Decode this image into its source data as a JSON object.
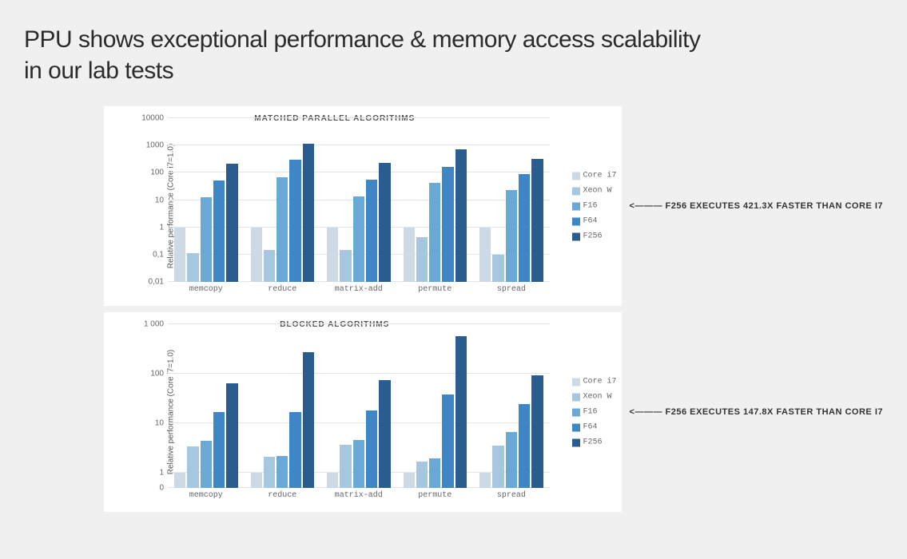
{
  "title_line1": "PPU shows exceptional performance & memory access scalability",
  "title_line2": "in our lab tests",
  "colors": {
    "Core i7": "#cdd9e5",
    "Xeon W": "#a7c6df",
    "F16": "#6aa9d6",
    "F64": "#3f86c4",
    "F256": "#2a5d8f"
  },
  "chart_data": [
    {
      "type": "bar",
      "title": "MATCHED PARALLEL ALGORITHMS",
      "ylabel": "Relative performance (Core i7=1.0)",
      "scale": "log",
      "ylim": [
        0.01,
        10000
      ],
      "yticks": [
        "0,01",
        "0,1",
        "1",
        "10",
        "100",
        "1000",
        "10000"
      ],
      "categories": [
        "memcopy",
        "reduce",
        "matrix-add",
        "permute",
        "spread"
      ],
      "series": [
        {
          "name": "Core i7",
          "values": [
            1,
            1,
            1,
            1,
            1
          ]
        },
        {
          "name": "Xeon W",
          "values": [
            0.11,
            0.15,
            0.15,
            0.45,
            0.1
          ]
        },
        {
          "name": "F16",
          "values": [
            13,
            70,
            14,
            42,
            23
          ]
        },
        {
          "name": "F64",
          "values": [
            52,
            300,
            55,
            160,
            90
          ]
        },
        {
          "name": "F256",
          "values": [
            210,
            1150,
            230,
            700,
            320
          ]
        }
      ],
      "annotation": "<——— F256 EXECUTES 421.3X FASTER THAN CORE I7"
    },
    {
      "type": "bar",
      "title": "BLOCKED ALGORITHMS",
      "ylabel": "Relative performance (Core i7=1.0)",
      "scale": "log",
      "ylim": [
        0.5,
        1000
      ],
      "yticks": [
        "0",
        "1",
        "10",
        "100",
        "1 000"
      ],
      "categories": [
        "memcopy",
        "reduce",
        "matrix-add",
        "permute",
        "spread"
      ],
      "series": [
        {
          "name": "Core i7",
          "values": [
            1,
            1,
            1,
            1,
            1
          ]
        },
        {
          "name": "Xeon W",
          "values": [
            3.5,
            2.1,
            3.7,
            1.7,
            3.6
          ]
        },
        {
          "name": "F16",
          "values": [
            4.4,
            2.2,
            4.6,
            2.0,
            6.6
          ]
        },
        {
          "name": "F64",
          "values": [
            17,
            17,
            18,
            38,
            25
          ]
        },
        {
          "name": "F256",
          "values": [
            65,
            270,
            75,
            580,
            95
          ]
        }
      ],
      "annotation": "<——— F256 EXECUTES 147.8X FASTER THAN CORE I7"
    }
  ]
}
